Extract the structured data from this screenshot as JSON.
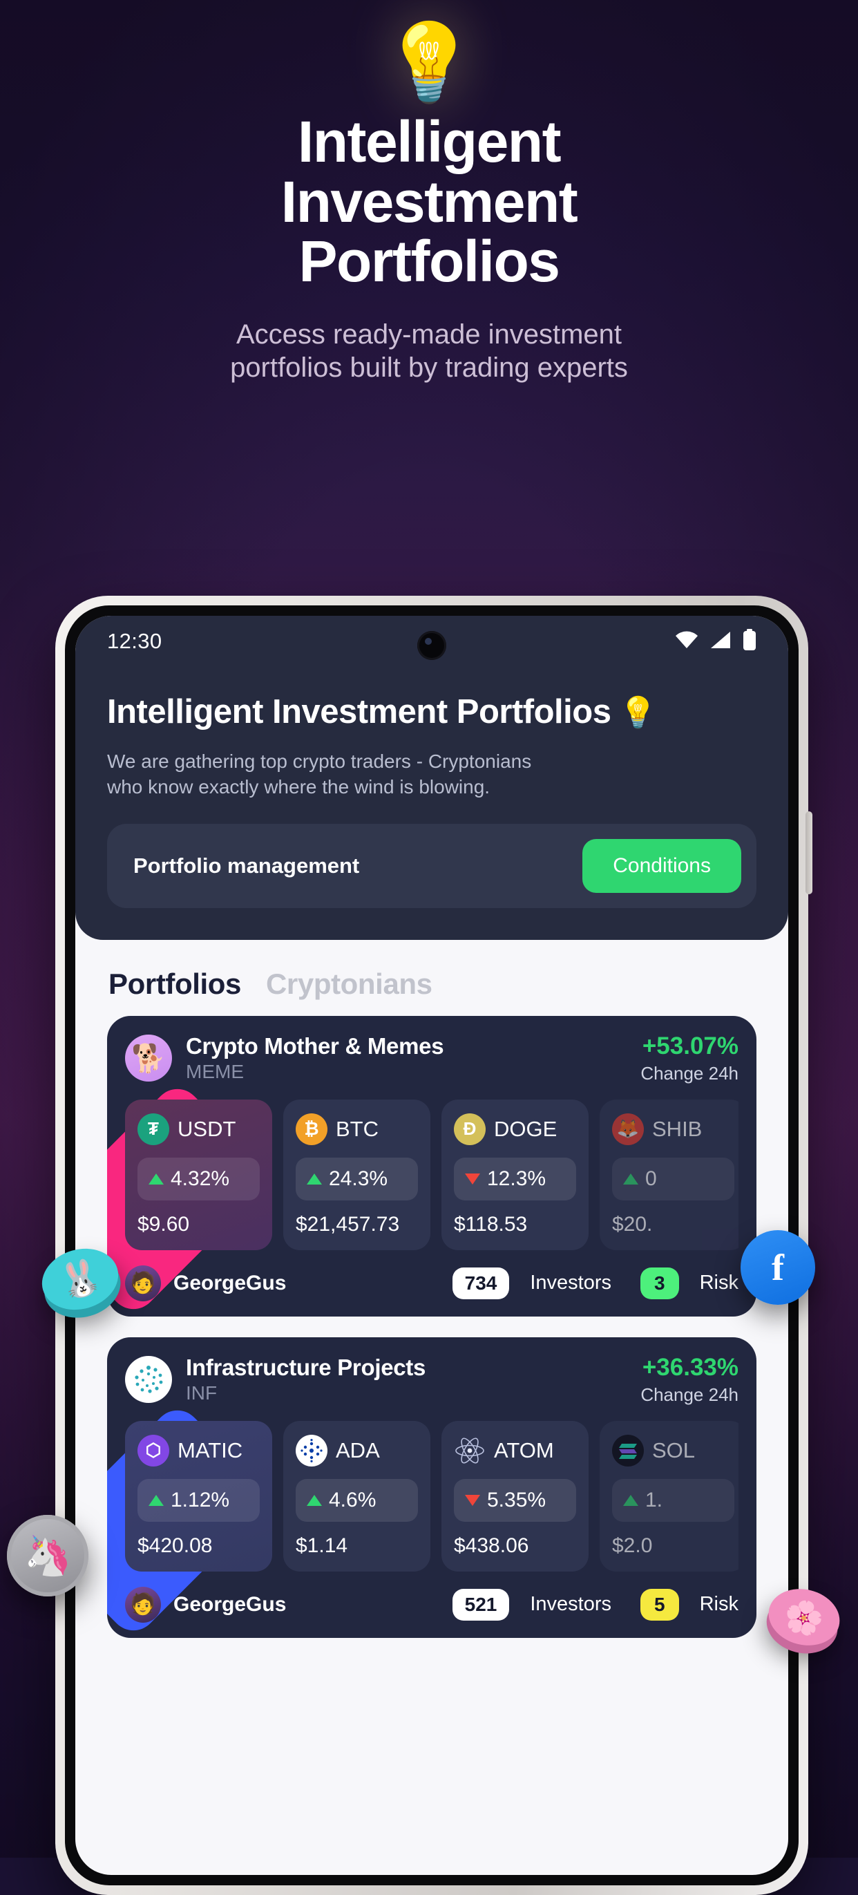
{
  "hero": {
    "bulb_icon": "light-bulb",
    "title_line1": "Intelligent",
    "title_line2": "Investment",
    "title_line3": "Portfolios",
    "subtitle_line1": "Access ready-made investment",
    "subtitle_line2": "portfolios built by trading experts"
  },
  "status_bar": {
    "time": "12:30",
    "icons": [
      "wifi-icon",
      "cellular-signal-icon",
      "battery-icon"
    ]
  },
  "app_header": {
    "title": "Intelligent Investment Portfolios",
    "title_emoji": "💡",
    "description_line1": "We are gathering top crypto traders - Cryptonians",
    "description_line2": "who know exactly where the wind is blowing.",
    "management_label": "Portfolio management",
    "conditions_button": "Conditions"
  },
  "tabs": [
    {
      "label": "Portfolios",
      "active": true
    },
    {
      "label": "Cryptonians",
      "active": false
    }
  ],
  "colors": {
    "accent_green": "#2fd670",
    "accent_red": "#f0453a",
    "card_bg": "#222740",
    "header_bg": "#262b3f",
    "risk_low": "#4df07c",
    "risk_mid": "#f5e93f",
    "accent_pink": "#f9277f",
    "accent_blue": "#3b5bfd"
  },
  "portfolios": [
    {
      "name": "Crypto Mother & Memes",
      "ticker": "MEME",
      "avatar_icon": "shiba-avatar-icon",
      "change": "+53.07%",
      "change_label": "Change 24h",
      "accent": "#f9277f",
      "tokens": [
        {
          "symbol": "USDT",
          "icon": "tether-icon",
          "direction": "up",
          "pct": "4.32%",
          "price": "$9.60"
        },
        {
          "symbol": "BTC",
          "icon": "bitcoin-icon",
          "direction": "up",
          "pct": "24.3%",
          "price": "$21,457.73"
        },
        {
          "symbol": "DOGE",
          "icon": "dogecoin-icon",
          "direction": "down",
          "pct": "12.3%",
          "price": "$118.53"
        },
        {
          "symbol": "SHIB",
          "icon": "shiba-inu-icon",
          "direction": "up",
          "pct": "0",
          "price": "$20."
        }
      ],
      "author": "GeorgeGus",
      "author_avatar_icon": "user-avatar-icon",
      "investors_count": "734",
      "investors_label": "Investors",
      "risk_value": "3",
      "risk_label": "Risk",
      "risk_color": "green"
    },
    {
      "name": "Infrastructure Projects",
      "ticker": "INF",
      "avatar_icon": "infrastructure-avatar-icon",
      "change": "+36.33%",
      "change_label": "Change 24h",
      "accent": "#3b5bfd",
      "tokens": [
        {
          "symbol": "MATIC",
          "icon": "polygon-icon",
          "direction": "up",
          "pct": "1.12%",
          "price": "$420.08"
        },
        {
          "symbol": "ADA",
          "icon": "cardano-icon",
          "direction": "up",
          "pct": "4.6%",
          "price": "$1.14"
        },
        {
          "symbol": "ATOM",
          "icon": "cosmos-icon",
          "direction": "down",
          "pct": "5.35%",
          "price": "$438.06"
        },
        {
          "symbol": "SOL",
          "icon": "solana-icon",
          "direction": "up",
          "pct": "1.",
          "price": "$2.0"
        }
      ],
      "author": "GeorgeGus",
      "author_avatar_icon": "user-avatar-icon",
      "investors_count": "521",
      "investors_label": "Investors",
      "risk_value": "5",
      "risk_label": "Risk",
      "risk_color": "yellow"
    }
  ],
  "floating_coins": [
    {
      "name": "pancakeswap-coin",
      "glyph": "🐰"
    },
    {
      "name": "unicorn-coin",
      "glyph": "🦄"
    },
    {
      "name": "fantom-coin",
      "glyph": "f"
    },
    {
      "name": "pink-coin",
      "glyph": "🌸"
    }
  ]
}
